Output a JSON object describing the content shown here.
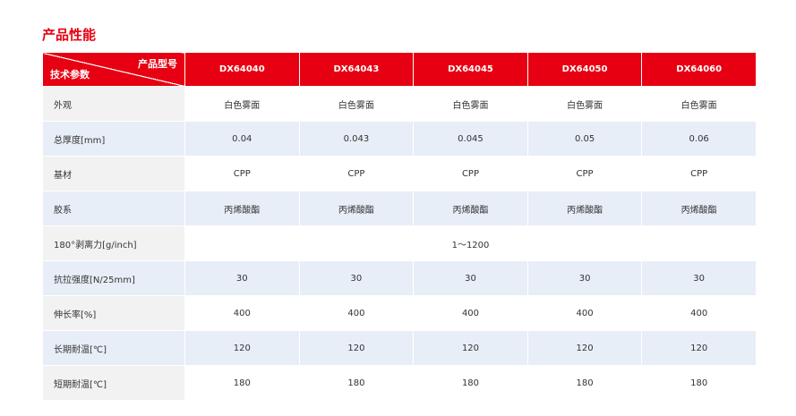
{
  "section_title": "产品性能",
  "table": {
    "corner_top": "产品型号",
    "corner_bottom": "技术参数",
    "models": [
      "DX64040",
      "DX64043",
      "DX64045",
      "DX64050",
      "DX64060"
    ],
    "rows": [
      {
        "param": "外观",
        "values": [
          "白色雾面",
          "白色雾面",
          "白色雾面",
          "白色雾面",
          "白色雾面"
        ]
      },
      {
        "param": "总厚度[mm]",
        "values": [
          "0.04",
          "0.043",
          "0.045",
          "0.05",
          "0.06"
        ]
      },
      {
        "param": "基材",
        "values": [
          "CPP",
          "CPP",
          "CPP",
          "CPP",
          "CPP"
        ]
      },
      {
        "param": "胶系",
        "values": [
          "丙烯酸酯",
          "丙烯酸酯",
          "丙烯酸酯",
          "丙烯酸酯",
          "丙烯酸酯"
        ]
      },
      {
        "param": "180°剥离力[g/inch]",
        "merged": "1～1200"
      },
      {
        "param": "抗拉强度[N/25mm]",
        "values": [
          "30",
          "30",
          "30",
          "30",
          "30"
        ]
      },
      {
        "param": "伸长率[%]",
        "values": [
          "400",
          "400",
          "400",
          "400",
          "400"
        ]
      },
      {
        "param": "长期耐温[℃]",
        "values": [
          "120",
          "120",
          "120",
          "120",
          "120"
        ]
      },
      {
        "param": "短期耐温[℃]",
        "values": [
          "180",
          "180",
          "180",
          "180",
          "180"
        ]
      }
    ]
  }
}
